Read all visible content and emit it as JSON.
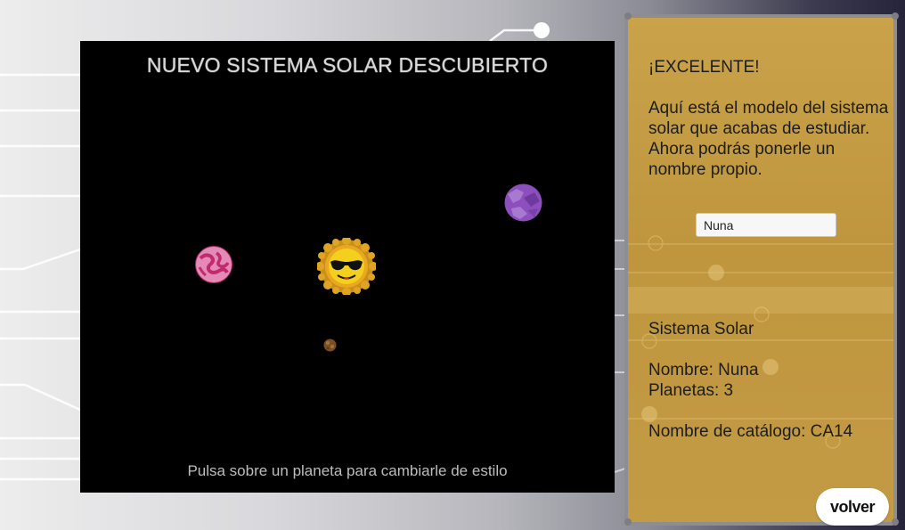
{
  "viewport": {
    "title": "NUEVO SISTEMA SOLAR DESCUBIERTO",
    "hint": "Pulsa sobre un planeta para cambiarle de estilo",
    "bodies": [
      {
        "name": "sun-sunglasses",
        "color": "#f2c21a"
      },
      {
        "name": "planet-pink",
        "color": "#d8468c"
      },
      {
        "name": "planet-purple",
        "color": "#8a4fb5"
      },
      {
        "name": "planet-brown-small",
        "color": "#8a5a2b"
      }
    ]
  },
  "panel": {
    "heading": "¡EXCELENTE!",
    "description": "Aquí está el modelo del sistema solar que acabas de estudiar. Ahora podrás ponerle un nombre propio.",
    "name_input_value": "Nuna",
    "info_title": "Sistema Solar",
    "info_name": "Nombre: Nuna",
    "info_planets": "Planetas: 3",
    "info_catalog": "Nombre de catálogo: CA14",
    "accent_color": "#c39b45"
  },
  "back_button_label": "volver"
}
